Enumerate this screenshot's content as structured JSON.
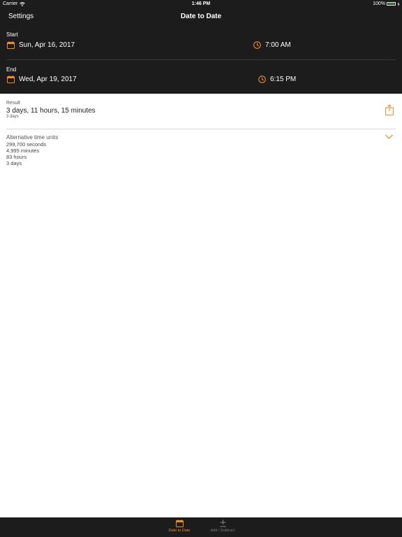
{
  "status": {
    "carrier": "Carrier",
    "time": "1:46 PM",
    "battery": "100%"
  },
  "nav": {
    "back_label": "Settings",
    "title": "Date to Date"
  },
  "start": {
    "label": "Start",
    "date": "Sun, Apr 16, 2017",
    "time": "7:00 AM"
  },
  "end": {
    "label": "End",
    "date": "Wed, Apr 19, 2017",
    "time": "6:15 PM"
  },
  "result": {
    "label": "Result",
    "value": "3 days, 11 hours, 15 minutes",
    "subvalue": "3 days"
  },
  "alternative": {
    "label": "Alternative time units",
    "items": [
      "299,700 seconds",
      "4,995 minutes",
      "83 hours",
      "3 days"
    ]
  },
  "tabs": [
    {
      "label": "Date to Date",
      "icon": "calendar-icon"
    },
    {
      "label": "Add / Subtract",
      "icon": "plus-minus-icon"
    }
  ],
  "colors": {
    "accent": "#f08a24",
    "dark_bg": "#1c1c1c",
    "battery": "#4cd964"
  }
}
